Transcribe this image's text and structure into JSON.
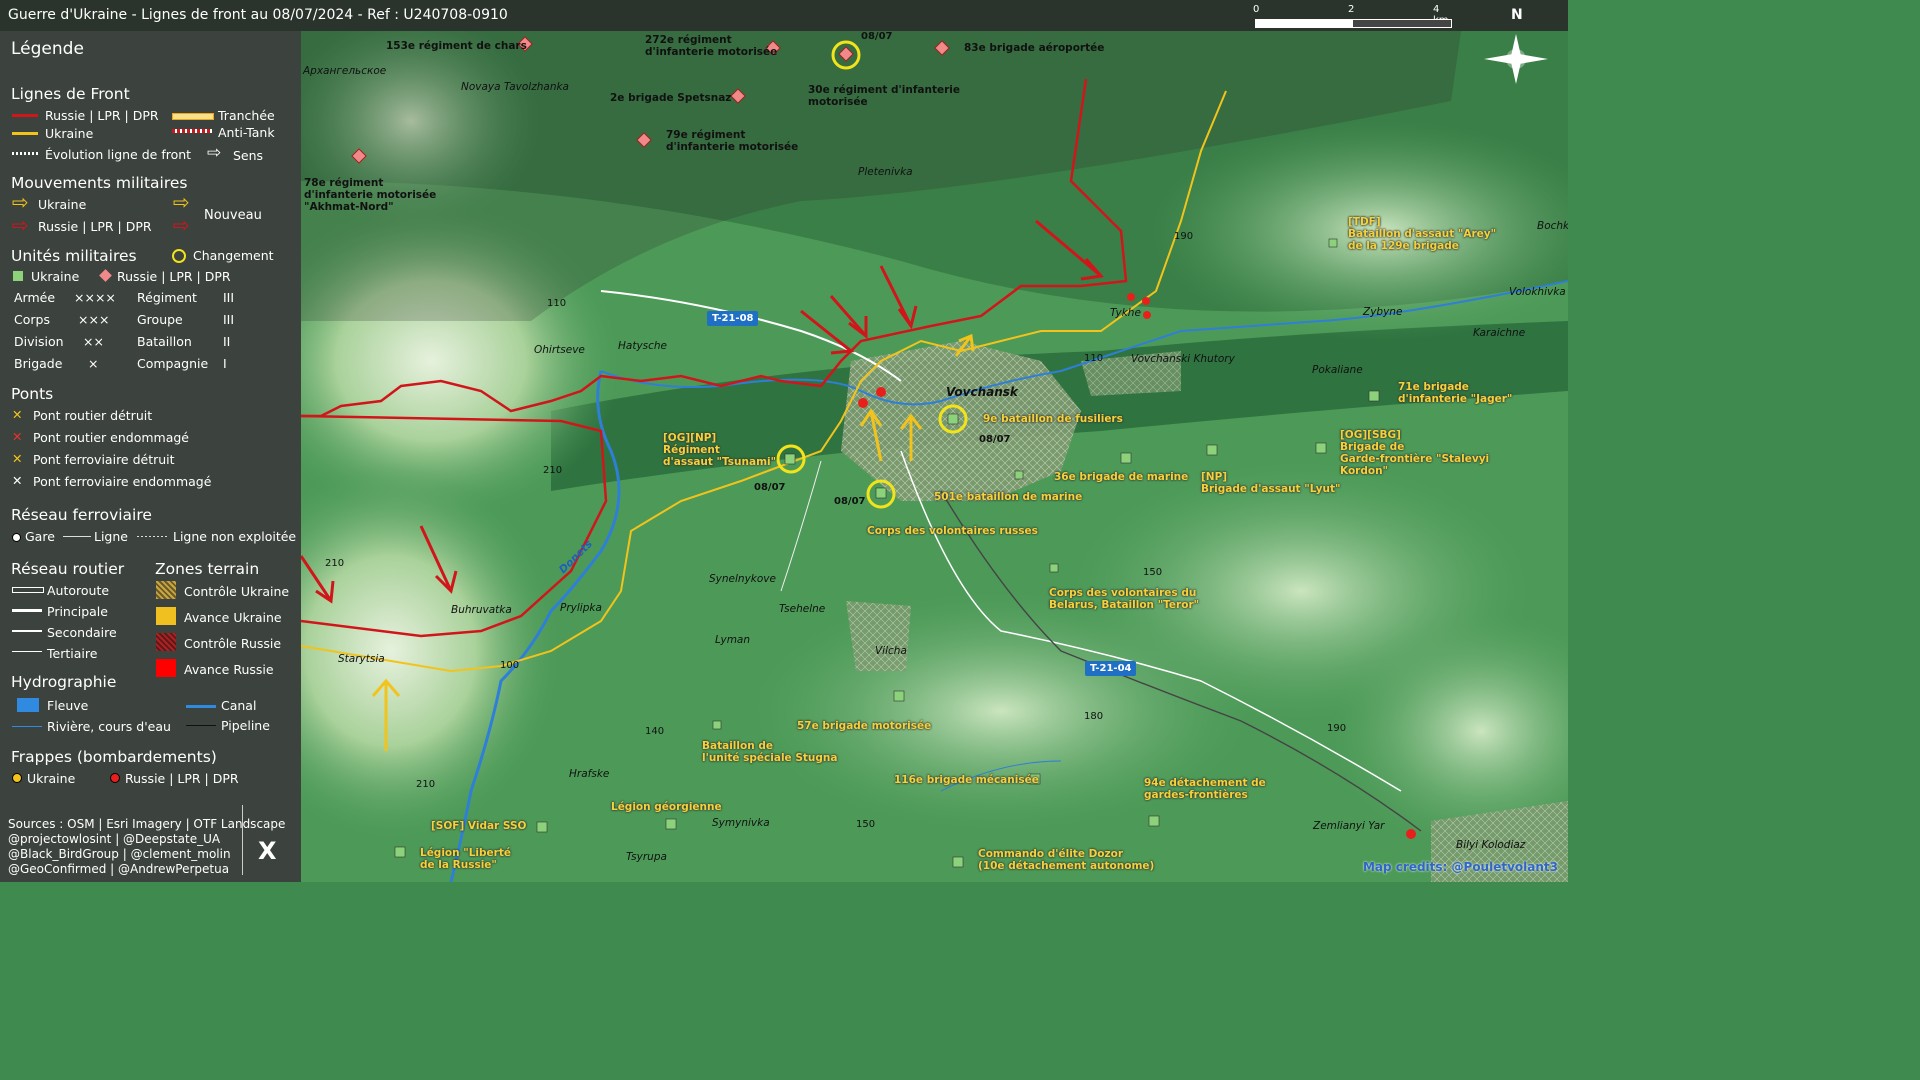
{
  "title": "Guerre d'Ukraine - Lignes de front au 08/07/2024 - Ref : U240708-0910",
  "scale": {
    "labels": [
      "0",
      "2",
      "4 km"
    ]
  },
  "north": "N",
  "legend": {
    "title": "Légende",
    "front_title": "Lignes de Front",
    "front_russia": "Russie | LPR | DPR",
    "front_ukraine": "Ukraine",
    "front_trench": "Tranchée",
    "front_antitank": "Anti-Tank",
    "front_evolution": "Évolution ligne de front",
    "front_direction": "Sens",
    "mov_title": "Mouvements militaires",
    "mov_ukraine": "Ukraine",
    "mov_russia": "Russie | LPR | DPR",
    "mov_new": "Nouveau",
    "units_title": "Unités militaires",
    "units_change": "Changement",
    "units_ukraine": "Ukraine",
    "units_russia": "Russie | LPR | DPR",
    "echelons": [
      {
        "name": "Armée",
        "sym": "××××"
      },
      {
        "name": "Corps",
        "sym": "×××"
      },
      {
        "name": "Division",
        "sym": "××"
      },
      {
        "name": "Brigade",
        "sym": "×"
      },
      {
        "name": "Régiment",
        "sym": "III"
      },
      {
        "name": "Groupe",
        "sym": "III"
      },
      {
        "name": "Bataillon",
        "sym": "II"
      },
      {
        "name": "Compagnie",
        "sym": "I"
      }
    ],
    "bridges_title": "Ponts",
    "bridges": [
      {
        "label": "Pont routier détruit",
        "color": "#f5c518"
      },
      {
        "label": "Pont routier endommagé",
        "color": "#e8322c"
      },
      {
        "label": "Pont ferroviaire détruit",
        "color": "#f5c518"
      },
      {
        "label": "Pont ferroviaire endommagé",
        "color": "#ffffff"
      }
    ],
    "rail_title": "Réseau ferroviaire",
    "rail_station": "Gare",
    "rail_line": "Ligne",
    "rail_unused": "Ligne non exploitée",
    "road_title": "Réseau routier",
    "roads": [
      "Autoroute",
      "Principale",
      "Secondaire",
      "Tertiaire"
    ],
    "zones_title": "Zones terrain",
    "zones": [
      {
        "label": "Contrôle Ukraine",
        "color": "#c9a640"
      },
      {
        "label": "Avance Ukraine",
        "color": "#f0c020"
      },
      {
        "label": "Contrôle Russie",
        "color": "#b02020"
      },
      {
        "label": "Avance Russie",
        "color": "#ff0000"
      }
    ],
    "hydro_title": "Hydrographie",
    "hydro_river": "Fleuve",
    "hydro_canal": "Canal",
    "hydro_stream": "Rivière, cours d'eau",
    "hydro_pipeline": "Pipeline",
    "strikes_title": "Frappes (bombardements)",
    "strikes_ukraine": "Ukraine",
    "strikes_russia": "Russie | LPR | DPR",
    "sources": [
      "Sources : OSM | Esri Imagery | OTF Landscape",
      "@projectowlosint | @Deepstate_UA",
      "@Black_BirdGroup | @clement_molin",
      "@GeoConfirmed | @AndrewPerpetua"
    ],
    "x_logo": "X"
  },
  "places": [
    {
      "name": "Архангельское"
    },
    {
      "name": "Novaya Tavolzhanka"
    },
    {
      "name": "Pletenivka"
    },
    {
      "name": "Tykhe"
    },
    {
      "name": "Zybyne"
    },
    {
      "name": "Vovchanski Khutory"
    },
    {
      "name": "Karaichne"
    },
    {
      "name": "Volokhivka"
    },
    {
      "name": "Bochk"
    },
    {
      "name": "Pokaliane"
    },
    {
      "name": "Vovchansk"
    },
    {
      "name": "Ohirtseve"
    },
    {
      "name": "Hatysche"
    },
    {
      "name": "Buhruvatka"
    },
    {
      "name": "Prylipka"
    },
    {
      "name": "Starytsia"
    },
    {
      "name": "Synelnykove"
    },
    {
      "name": "Tsehelne"
    },
    {
      "name": "Lyman"
    },
    {
      "name": "Vilcha"
    },
    {
      "name": "Hrafske"
    },
    {
      "name": "Symynivka"
    },
    {
      "name": "Tsyrupa"
    },
    {
      "name": "Zemlianyi Yar"
    },
    {
      "name": "Bilyi Kolodiaz"
    },
    {
      "name": "Donets"
    }
  ],
  "elevations": [
    "190",
    "110",
    "110",
    "210",
    "210",
    "150",
    "100",
    "140",
    "180",
    "190",
    "210",
    "150"
  ],
  "roads": [
    "T-21-08",
    "T-21-04"
  ],
  "russian_units": [
    "153e régiment de chars",
    "272e régiment\nd'infanterie motorisée",
    "83e brigade aéroportée",
    "2e brigade Spetsnaz",
    "30e régiment d'infanterie\nmotorisée",
    "79e régiment\nd'infanterie motorisée",
    "78e régiment\nd'infanterie motorisée\n\"Akhmat-Nord\""
  ],
  "ukrainian_units": [
    "[TDF]\nBataillon d'assaut \"Arey\"\nde la 129e brigade",
    "71e brigade\nd'infanterie \"Jager\"",
    "[OG][SBG]\nBrigade de\nGarde-frontière \"Stalevyi\nKordon\"",
    "[NP]\nBrigade d'assaut \"Lyut\"",
    "36e brigade de marine",
    "9e bataillon de fusiliers",
    "501e bataillon de marine",
    "Corps des volontaires russes",
    "[OG][NP]\nRégiment\nd'assaut \"Tsunami\"",
    "Corps des volontaires du\nBelarus, Bataillon \"Teror\"",
    "57e brigade motorisée",
    "Bataillon de\nl'unité spéciale Stugna",
    "116e brigade mécanisée",
    "94e détachement de\ngardes-frontières",
    "Légion géorgienne",
    "[SOF] Vidar SSO",
    "Légion \"Liberté\nde la Russie\"",
    "Commando d'élite Dozor\n(10e détachement autonome)"
  ],
  "dates": [
    "08/07",
    "08/07",
    "08/07",
    "08/07"
  ],
  "credit": "Map credits: @Pouletvolant3",
  "colors": {
    "russia": "#d0161b",
    "ukraine": "#f2c31b",
    "panel": "#3c3c3c",
    "water": "#2f7fd8"
  }
}
